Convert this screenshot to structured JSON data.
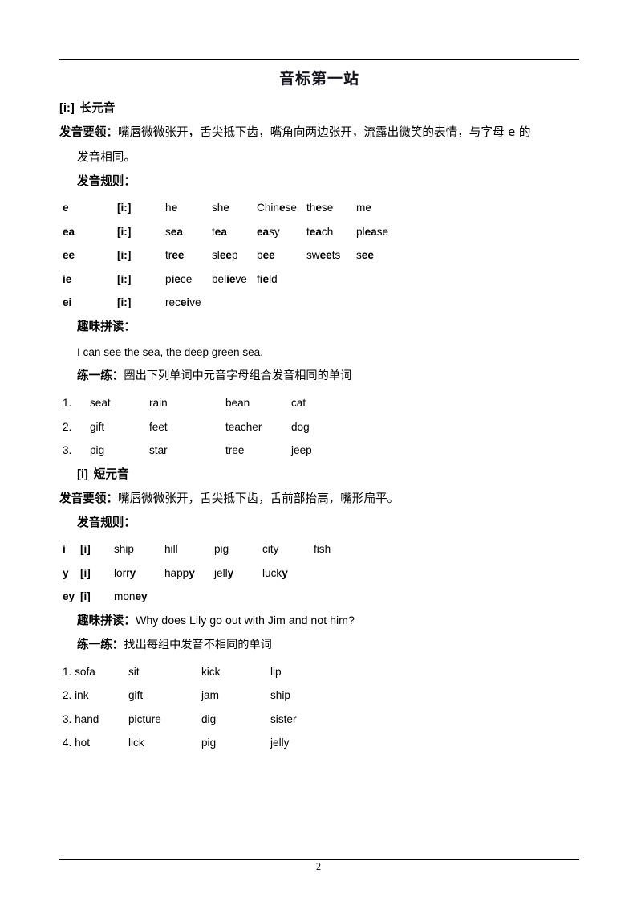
{
  "document": {
    "title": "音标第一站",
    "page_number": "2"
  },
  "long_vowel": {
    "symbol": "[i:]",
    "label": "长元音",
    "essentials_label": "发音要领：",
    "essentials_text_line1": "嘴唇微微张开，舌尖抵下齿，嘴角向两边张开，流露出微笑的表情，与字母 e 的",
    "essentials_text_line2": "发音相同。",
    "rules_label": "发音规则：",
    "rules": [
      {
        "letters": "e",
        "ipa": "[i:]",
        "words": [
          {
            "pre": "h",
            "key": "e",
            "post": ""
          },
          {
            "pre": "sh",
            "key": "e",
            "post": ""
          },
          {
            "pre": "Chin",
            "key": "e",
            "post": "se"
          },
          {
            "pre": "th",
            "key": "e",
            "post": "se"
          },
          {
            "pre": "m",
            "key": "e",
            "post": ""
          }
        ]
      },
      {
        "letters": "ea",
        "ipa": "[i:]",
        "words": [
          {
            "pre": "s",
            "key": "ea",
            "post": ""
          },
          {
            "pre": "t",
            "key": "ea",
            "post": ""
          },
          {
            "pre": "",
            "key": "ea",
            "post": "sy"
          },
          {
            "pre": "t",
            "key": "ea",
            "post": "ch"
          },
          {
            "pre": "pl",
            "key": "ea",
            "post": "se"
          }
        ]
      },
      {
        "letters": "ee",
        "ipa": "[i:]",
        "words": [
          {
            "pre": "tr",
            "key": "ee",
            "post": ""
          },
          {
            "pre": "sl",
            "key": "ee",
            "post": "p"
          },
          {
            "pre": "b",
            "key": "ee",
            "post": ""
          },
          {
            "pre": "sw",
            "key": "ee",
            "post": "ts"
          },
          {
            "pre": "s",
            "key": "ee",
            "post": ""
          }
        ]
      },
      {
        "letters": "ie",
        "ipa": "[i:]",
        "words": [
          {
            "pre": "p",
            "key": "ie",
            "post": "ce"
          },
          {
            "pre": "bel",
            "key": "ie",
            "post": "ve"
          },
          {
            "pre": "f",
            "key": "ie",
            "post": "ld"
          },
          {
            "pre": "",
            "key": "",
            "post": ""
          },
          {
            "pre": "",
            "key": "",
            "post": ""
          }
        ]
      },
      {
        "letters": "ei",
        "ipa": "[i:]",
        "words": [
          {
            "pre": "rec",
            "key": "ei",
            "post": "ve"
          },
          {
            "pre": "",
            "key": "",
            "post": ""
          },
          {
            "pre": "",
            "key": "",
            "post": ""
          },
          {
            "pre": "",
            "key": "",
            "post": ""
          },
          {
            "pre": "",
            "key": "",
            "post": ""
          }
        ]
      }
    ],
    "fun_label": "趣味拼读：",
    "fun_sentence": "I can see the sea, the deep green sea.",
    "practice_label": "练一练：",
    "practice_instruction": "圈出下列单词中元音字母组合发音相同的单词",
    "practice_rows": [
      {
        "num": "1.",
        "w1": "seat",
        "w2": "rain",
        "w3": "bean",
        "w4": "cat"
      },
      {
        "num": "2.",
        "w1": "gift",
        "w2": "feet",
        "w3": "teacher",
        "w4": "dog"
      },
      {
        "num": "3.",
        "w1": "pig",
        "w2": "star",
        "w3": "tree",
        "w4": "jeep"
      }
    ]
  },
  "short_vowel": {
    "symbol": "[i]",
    "label": "短元音",
    "essentials_label": "发音要领：",
    "essentials_text": "嘴唇微微张开，舌尖抵下齿，舌前部抬高，嘴形扁平。",
    "rules_label": "发音规则：",
    "rules": [
      {
        "letters": "i",
        "ipa": "[i]",
        "words": [
          {
            "pre": "ship",
            "key": "",
            "post": ""
          },
          {
            "pre": "hill",
            "key": "",
            "post": ""
          },
          {
            "pre": "pig",
            "key": "",
            "post": ""
          },
          {
            "pre": "city",
            "key": "",
            "post": ""
          },
          {
            "pre": "fish",
            "key": "",
            "post": ""
          }
        ]
      },
      {
        "letters": "y",
        "ipa": "[i]",
        "words": [
          {
            "pre": "lorr",
            "key": "y",
            "post": ""
          },
          {
            "pre": "happ",
            "key": "y",
            "post": ""
          },
          {
            "pre": "jell",
            "key": "y",
            "post": ""
          },
          {
            "pre": "luck",
            "key": "y",
            "post": ""
          },
          {
            "pre": "",
            "key": "",
            "post": ""
          }
        ]
      },
      {
        "letters": "ey",
        "ipa": "[i]",
        "words": [
          {
            "pre": "mon",
            "key": "ey",
            "post": ""
          },
          {
            "pre": "",
            "key": "",
            "post": ""
          },
          {
            "pre": "",
            "key": "",
            "post": ""
          },
          {
            "pre": "",
            "key": "",
            "post": ""
          },
          {
            "pre": "",
            "key": "",
            "post": ""
          }
        ]
      }
    ],
    "fun_label": "趣味拼读：",
    "fun_sentence": "Why does Lily go out with Jim and not him?",
    "practice_label": "练一练：",
    "practice_instruction": "找出每组中发音不相同的单词",
    "practice_rows": [
      {
        "numword": "1. sofa",
        "w2": "sit",
        "w3": "kick",
        "w4": "lip"
      },
      {
        "numword": "2. ink",
        "w2": "gift",
        "w3": "jam",
        "w4": "ship"
      },
      {
        "numword": "3. hand",
        "w2": "picture",
        "w3": "dig",
        "w4": "sister"
      },
      {
        "numword": "4. hot",
        "w2": "lick",
        "w3": "pig",
        "w4": "jelly"
      }
    ]
  }
}
